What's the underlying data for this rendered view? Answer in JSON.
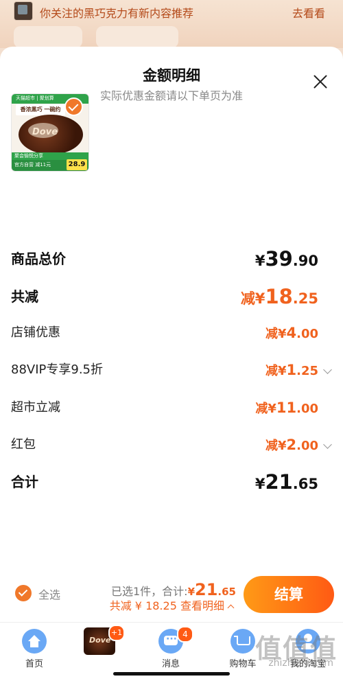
{
  "banner": {
    "message": "你关注的黑巧克力有新内容推荐",
    "action": "去看看"
  },
  "sheet": {
    "title": "金额明细",
    "subtitle": "实际优惠金额请以下单页为准"
  },
  "product": {
    "top_tag": "天猫超市 | 聚划算",
    "tagline": "香浓黑巧 一碗约",
    "brand": "Dove",
    "promo_strip": "聚会愉悦分享",
    "promo_bottom": "官方自营 减11元",
    "price_tag": "28.9"
  },
  "rows": [
    {
      "label": "商品总价",
      "symbol": "¥",
      "int": "39",
      "dec": ".90",
      "style": "total",
      "chevron": false
    },
    {
      "label": "共减",
      "symbol": "减¥",
      "int": "18",
      "dec": ".25",
      "style": "discount-total",
      "chevron": false
    },
    {
      "label": "店铺优惠",
      "symbol": "减¥",
      "int": "4",
      "dec": ".00",
      "style": "item",
      "chevron": false
    },
    {
      "label": "88VIP专享9.5折",
      "symbol": "减¥",
      "int": "1",
      "dec": ".25",
      "style": "item",
      "chevron": true
    },
    {
      "label": "超市立减",
      "symbol": "减¥",
      "int": "11",
      "dec": ".00",
      "style": "item",
      "chevron": false
    },
    {
      "label": "红包",
      "symbol": "减¥",
      "int": "2",
      "dec": ".00",
      "style": "item",
      "chevron": true
    },
    {
      "label": "合计",
      "symbol": "¥",
      "int": "21",
      "dec": ".65",
      "style": "total",
      "chevron": false
    }
  ],
  "footer": {
    "select_all": "全选",
    "selected_text": "已选1件，合计:",
    "sum_symbol": "¥",
    "sum_int": "21",
    "sum_dec": ".65",
    "discount_text": "共减 ¥ 18.25",
    "detail_link": "查看明细",
    "checkout": "结算"
  },
  "tabs": {
    "home": "首页",
    "product_badge": "+1",
    "product_brand": "Dove",
    "messages": "消息",
    "messages_badge": "4",
    "cart": "购物车",
    "me": "我的淘宝"
  },
  "watermark": {
    "glyphs": "值值值",
    "url": "zhizhizhi.com"
  },
  "colors": {
    "accent": "#f0621e",
    "checkout_start": "#ff9a16",
    "checkout_end": "#ff5a14",
    "tab_icon": "#6aa8f5"
  }
}
